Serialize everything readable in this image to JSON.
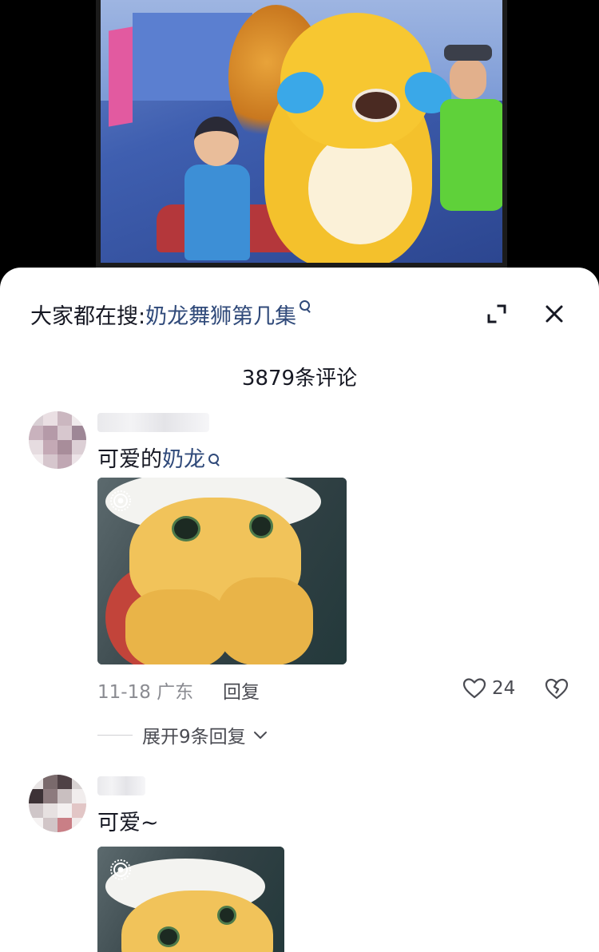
{
  "search": {
    "prefix": "大家都在搜:",
    "term": "奶龙舞狮第几集"
  },
  "comment_count": "3879条评论",
  "comments": [
    {
      "text_plain": "可爱的",
      "text_link": "奶龙",
      "date_location": "11-18 广东",
      "reply_label": "回复",
      "likes": "24",
      "expand_label": "展开9条回复"
    },
    {
      "text_plain": "可爱~",
      "text_link": ""
    }
  ],
  "colors": {
    "link": "#304a7a",
    "text": "#161823",
    "meta": "#8a8b91"
  },
  "icons": [
    "expand-icon",
    "close-icon",
    "search-icon",
    "live-photo-icon",
    "heart-icon",
    "broken-heart-icon",
    "chevron-down-icon"
  ]
}
